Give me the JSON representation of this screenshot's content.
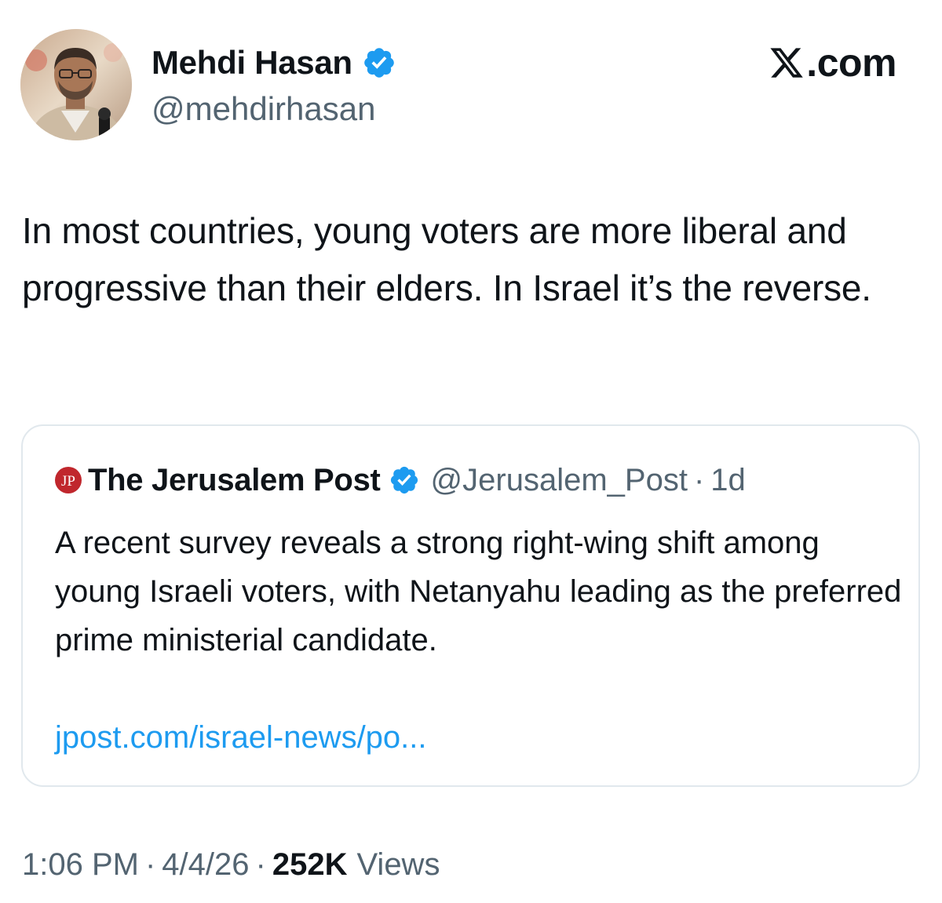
{
  "author": {
    "name": "Mehdi Hasan",
    "handle": "@mehdirhasan",
    "verified": true
  },
  "brand": {
    "label": "X.com",
    "mark": "𝕏",
    "suffix": ".com"
  },
  "tweet": {
    "text": "In most countries, young voters are more liberal and progressive than their elders. In Israel it’s the reverse."
  },
  "quoted_tweet": {
    "logo_text": "JP",
    "name": "The Jerusalem Post",
    "handle": "@Jerusalem_Post",
    "separator": "·",
    "time": "1d",
    "text": "A recent survey reveals a strong right-wing shift among young Israeli voters, with Netanyahu leading as the preferred prime ministerial candidate.",
    "link": "jpost.com/israel-news/po..."
  },
  "meta": {
    "time": "1:06 PM",
    "separator": "·",
    "date": "4/4/26",
    "views_count": "252K",
    "views_label": "Views"
  },
  "colors": {
    "verified_blue": "#1d9bf0",
    "jp_red": "#c0272d",
    "link_blue": "#1d9bf0",
    "secondary_text": "#536471"
  }
}
